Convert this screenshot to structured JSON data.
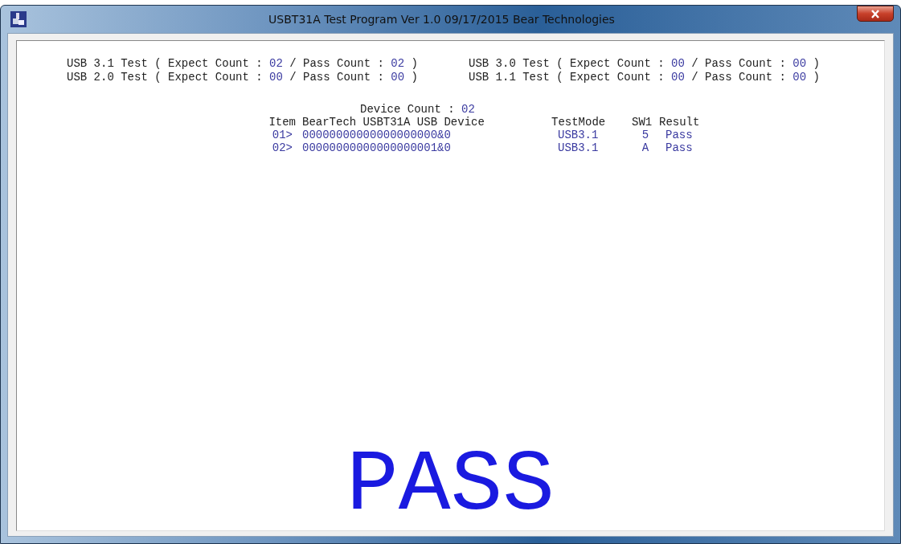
{
  "window": {
    "title": "USBT31A Test Program Ver 1.0  09/17/2015 Bear Technologies"
  },
  "tests": [
    {
      "segments": [
        {
          "kind": "label",
          "text": "USB 3.1 Test ( Expect Count : "
        },
        {
          "kind": "value",
          "text": "02"
        },
        {
          "kind": "label",
          "text": " / Pass Count : "
        },
        {
          "kind": "value",
          "text": "02"
        },
        {
          "kind": "label",
          "text": " )"
        }
      ]
    },
    {
      "segments": [
        {
          "kind": "label",
          "text": "USB 3.0 Test ( Expect Count : "
        },
        {
          "kind": "value",
          "text": "00"
        },
        {
          "kind": "label",
          "text": " / Pass Count : "
        },
        {
          "kind": "value",
          "text": "00"
        },
        {
          "kind": "label",
          "text": " )"
        }
      ]
    },
    {
      "segments": [
        {
          "kind": "label",
          "text": "USB 2.0 Test ( Expect Count : "
        },
        {
          "kind": "value",
          "text": "00"
        },
        {
          "kind": "label",
          "text": " / Pass Count : "
        },
        {
          "kind": "value",
          "text": "00"
        },
        {
          "kind": "label",
          "text": " )"
        }
      ]
    },
    {
      "segments": [
        {
          "kind": "label",
          "text": "USB 1.1 Test ( Expect Count : "
        },
        {
          "kind": "value",
          "text": "00"
        },
        {
          "kind": "label",
          "text": " / Pass Count : "
        },
        {
          "kind": "value",
          "text": "00"
        },
        {
          "kind": "label",
          "text": " )"
        }
      ]
    }
  ],
  "device_count": {
    "label": "Device Count :",
    "value": "02"
  },
  "table": {
    "columns": [
      "Item",
      "BearTech USBT31A USB Device",
      "TestMode",
      "SW1",
      "Result"
    ],
    "rows": [
      [
        "01>",
        "00000000000000000000&0",
        "USB3.1",
        "5",
        "Pass"
      ],
      [
        "02>",
        "00000000000000000001&0",
        "USB3.1",
        "A",
        "Pass"
      ]
    ]
  },
  "result": "PASS"
}
